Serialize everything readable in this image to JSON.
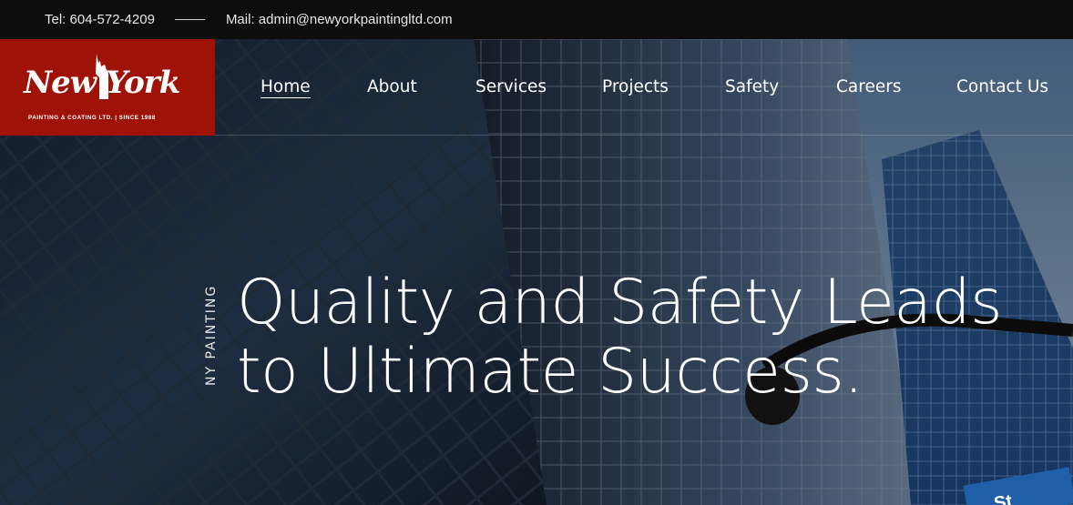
{
  "topbar": {
    "phone": "Tel: 604-572-4209",
    "email": "Mail: admin@newyorkpaintingltd.com"
  },
  "logo": {
    "script_text": "New York",
    "tagline": "PAINTING & COATING LTD. | SINCE 1988"
  },
  "nav": {
    "items": [
      {
        "label": "Home",
        "active": true
      },
      {
        "label": "About"
      },
      {
        "label": "Services"
      },
      {
        "label": "Projects"
      },
      {
        "label": "Safety"
      },
      {
        "label": "Careers"
      },
      {
        "label": "Contact Us"
      }
    ]
  },
  "hero": {
    "kicker": "NY PAINTING",
    "headline_line1": "Quality and Safety Leads",
    "headline_line2": "to Ultimate Success.",
    "street_sign": "St"
  },
  "colors": {
    "brand_red": "#9e1208",
    "topbar_bg": "#0d0d0d"
  }
}
